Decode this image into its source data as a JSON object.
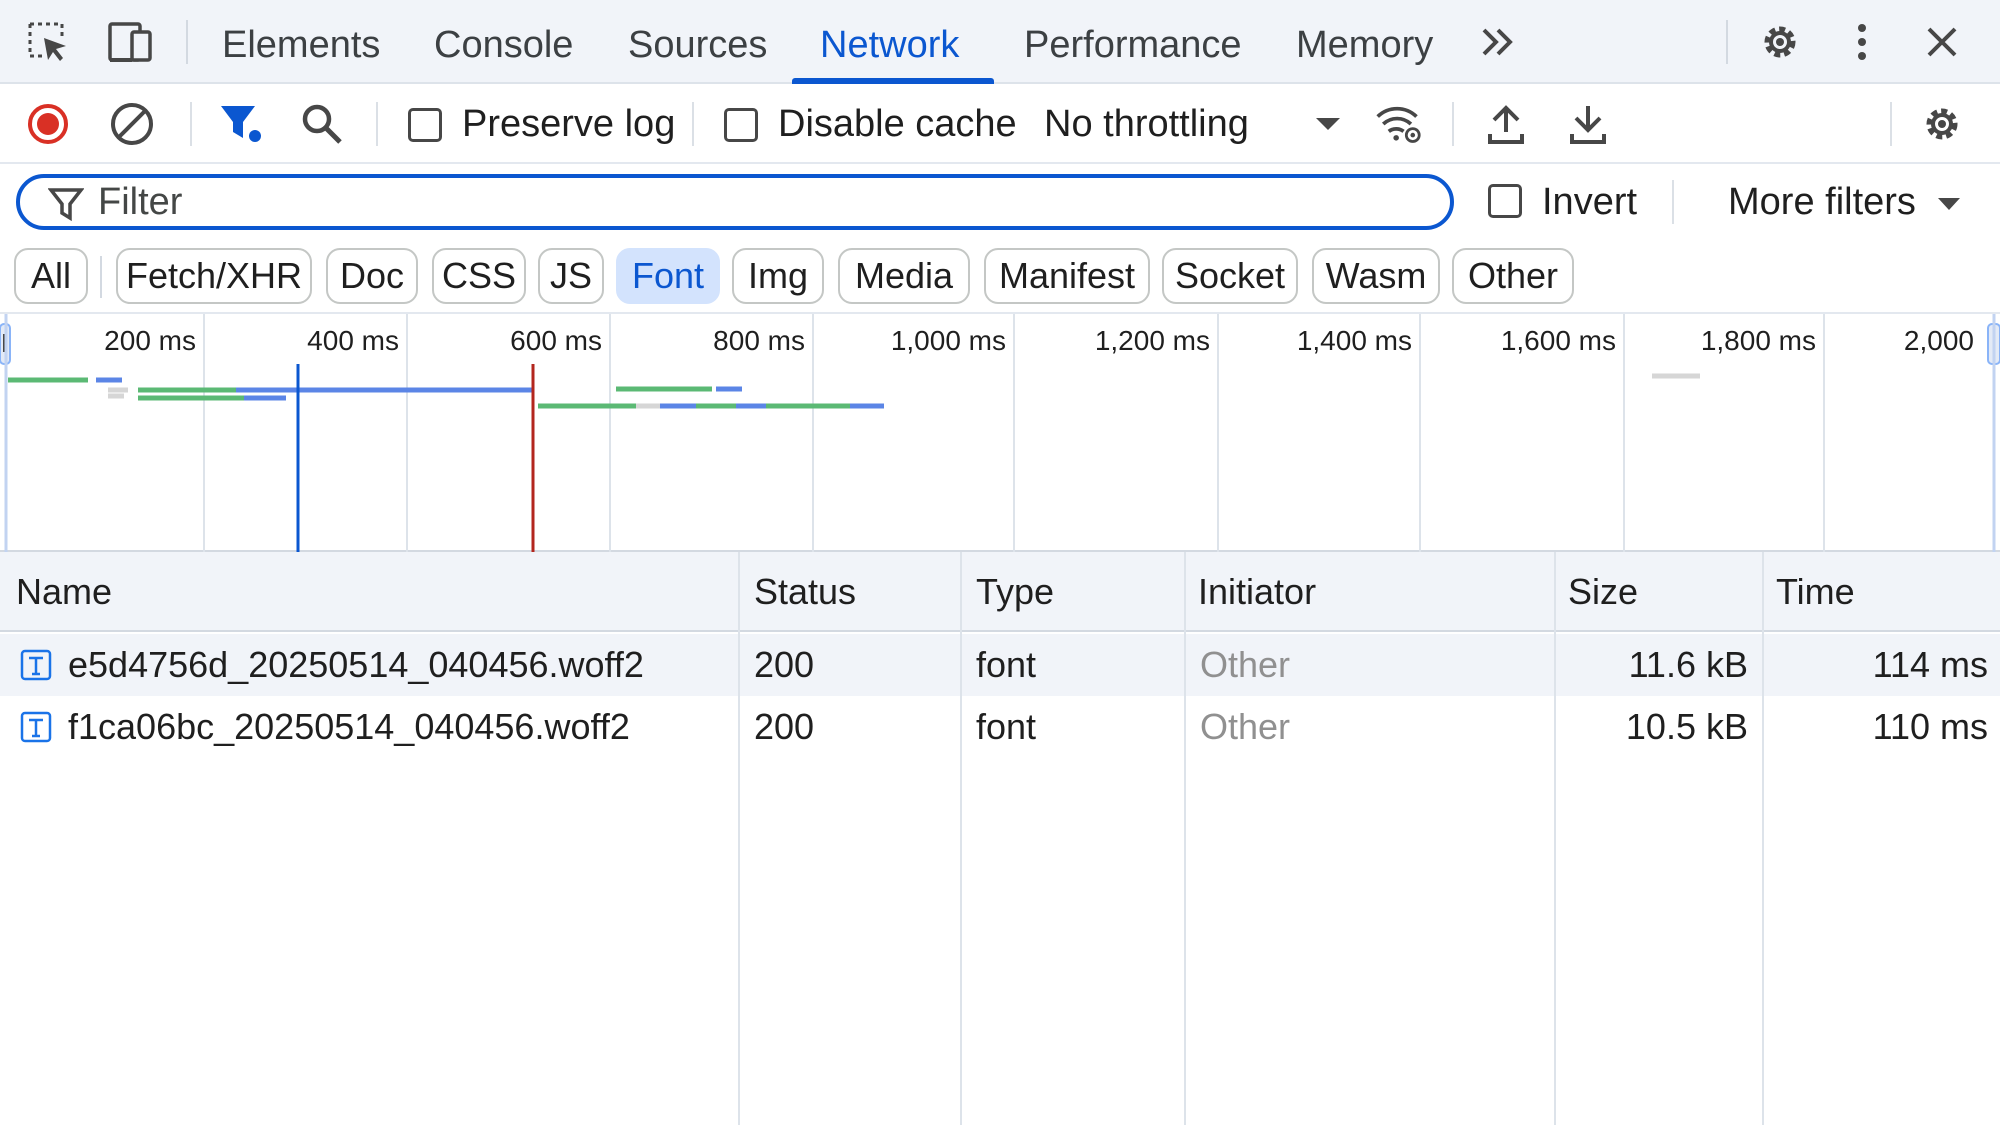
{
  "tabs": {
    "items": [
      "Elements",
      "Console",
      "Sources",
      "Network",
      "Performance",
      "Memory"
    ],
    "active": "Network"
  },
  "toolbar": {
    "preserve_log": "Preserve log",
    "disable_cache": "Disable cache",
    "throttling": "No throttling"
  },
  "filter": {
    "placeholder": "Filter",
    "invert_label": "Invert",
    "more_filters": "More filters"
  },
  "chips": {
    "items": [
      "All",
      "Fetch/XHR",
      "Doc",
      "CSS",
      "JS",
      "Font",
      "Img",
      "Media",
      "Manifest",
      "Socket",
      "Wasm",
      "Other"
    ],
    "active": "Font"
  },
  "overview": {
    "ticks": [
      "200 ms",
      "400 ms",
      "600 ms",
      "800 ms",
      "1,000 ms",
      "1,200 ms",
      "1,400 ms",
      "1,600 ms",
      "1,800 ms",
      "2,000"
    ],
    "dom_content_loaded_ms": 290,
    "load_ms": 522
  },
  "table": {
    "headers": {
      "name": "Name",
      "status": "Status",
      "type": "Type",
      "initiator": "Initiator",
      "size": "Size",
      "time": "Time"
    },
    "rows": [
      {
        "name": "e5d4756d_20250514_040456.woff2",
        "status": "200",
        "type": "font",
        "initiator": "Other",
        "size": "11.6 kB",
        "time": "114 ms"
      },
      {
        "name": "f1ca06bc_20250514_040456.woff2",
        "status": "200",
        "type": "font",
        "initiator": "Other",
        "size": "10.5 kB",
        "time": "110 ms"
      }
    ]
  },
  "colors": {
    "accent": "#0b57d0",
    "record_red": "#d93025",
    "waiting_green": "#5bb974",
    "download_blue": "#5b85e6",
    "load_line_red": "#b3261e"
  }
}
